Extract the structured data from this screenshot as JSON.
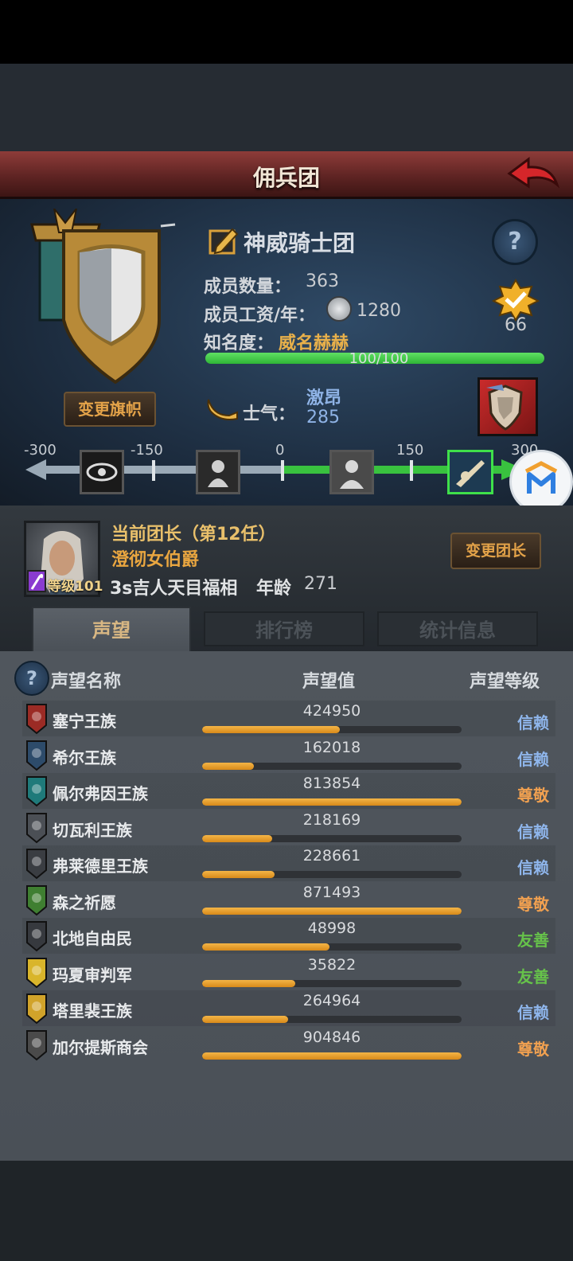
{
  "title": "佣兵团",
  "guild": {
    "name": "神威骑士团",
    "members_label": "成员数量：",
    "members_value": "363",
    "salary_label": "成员工资/年：",
    "salary_value": "1280",
    "fame_label": "知名度：",
    "fame_value": "威名赫赫",
    "fame_progress": "100/100",
    "fame_fraction": 1.0,
    "badge_count": "66",
    "change_flag_button": "变更旗帜"
  },
  "morale": {
    "label": "士气：",
    "word": "激昂",
    "value": "285",
    "ticks": [
      "-300",
      "-150",
      "0",
      "150",
      "300"
    ],
    "min": -300,
    "max": 300,
    "current": 285
  },
  "leader": {
    "title": "当前团长（第12任）",
    "name": "澄彻女伯爵",
    "traits": "3s吉人天目福相",
    "age_label": "年龄",
    "age_value": "271",
    "level_label": "等级101",
    "change_button": "变更团长"
  },
  "tabs": [
    "声望",
    "排行榜",
    "统计信息"
  ],
  "list": {
    "help": "?",
    "headers": {
      "name": "声望名称",
      "value": "声望值",
      "level": "声望等级"
    },
    "rows": [
      {
        "name": "塞宁王族",
        "value": "424950",
        "fill": 0.53,
        "level": "信赖",
        "level_color": "#8fb6ec",
        "crest_color": "#9b2b25"
      },
      {
        "name": "希尔王族",
        "value": "162018",
        "fill": 0.2,
        "level": "信赖",
        "level_color": "#8fb6ec",
        "crest_color": "#2d4b6a"
      },
      {
        "name": "佩尔弗因王族",
        "value": "813854",
        "fill": 1.0,
        "level": "尊敬",
        "level_color": "#f0a050",
        "crest_color": "#1f7a7a"
      },
      {
        "name": "切瓦利王族",
        "value": "218169",
        "fill": 0.27,
        "level": "信赖",
        "level_color": "#8fb6ec",
        "crest_color": "#4b4f55"
      },
      {
        "name": "弗莱德里王族",
        "value": "228661",
        "fill": 0.28,
        "level": "信赖",
        "level_color": "#8fb6ec",
        "crest_color": "#3a3d42"
      },
      {
        "name": "森之祈愿",
        "value": "871493",
        "fill": 1.0,
        "level": "尊敬",
        "level_color": "#f0a050",
        "crest_color": "#3f7f31"
      },
      {
        "name": "北地自由民",
        "value": "48998",
        "fill": 0.49,
        "level": "友善",
        "level_color": "#66c24a",
        "crest_color": "#36393e"
      },
      {
        "name": "玛夏审判军",
        "value": "35822",
        "fill": 0.36,
        "level": "友善",
        "level_color": "#66c24a",
        "crest_color": "#d9b52b"
      },
      {
        "name": "塔里裴王族",
        "value": "264964",
        "fill": 0.33,
        "level": "信赖",
        "level_color": "#8fb6ec",
        "crest_color": "#d1a32a"
      },
      {
        "name": "加尔提斯商会",
        "value": "904846",
        "fill": 1.0,
        "level": "尊敬",
        "level_color": "#f0a050",
        "crest_color": "#4a4a4a"
      }
    ]
  }
}
